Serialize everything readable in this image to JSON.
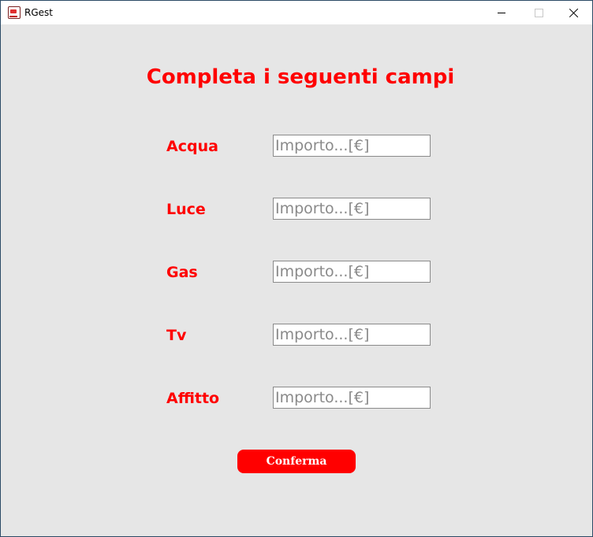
{
  "window": {
    "title": "RGest"
  },
  "form": {
    "heading": "Completa i seguenti campi",
    "fields": [
      {
        "label": "Acqua",
        "value": "",
        "placeholder": "Importo...[€]"
      },
      {
        "label": "Luce",
        "value": "",
        "placeholder": "Importo...[€]"
      },
      {
        "label": "Gas",
        "value": "",
        "placeholder": "Importo...[€]"
      },
      {
        "label": "Tv",
        "value": "",
        "placeholder": "Importo...[€]"
      },
      {
        "label": "Affitto",
        "value": "",
        "placeholder": "Importo...[€]"
      }
    ],
    "confirm_label": "Conferma"
  },
  "colors": {
    "accent": "#ff0000",
    "background": "#e6e6e6",
    "input_border": "#8a8a8a",
    "placeholder": "#8a8a8a"
  },
  "icons": {
    "app": "app-icon",
    "minimize": "minimize-icon",
    "maximize": "maximize-icon",
    "close": "close-icon"
  }
}
